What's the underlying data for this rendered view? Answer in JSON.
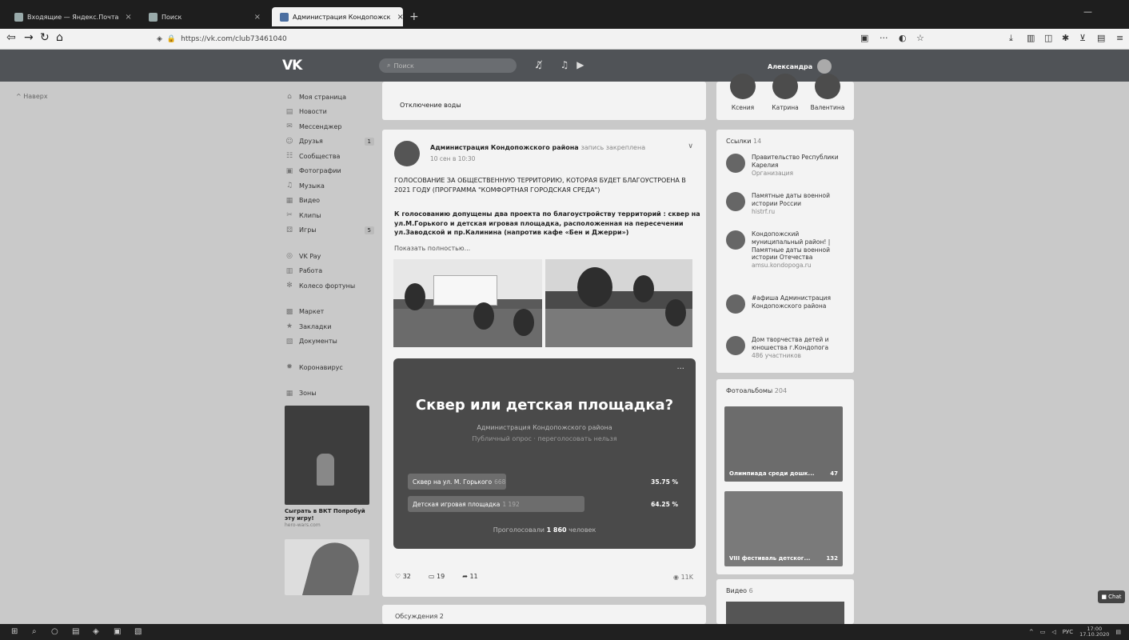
{
  "browser": {
    "tabs": [
      {
        "label": "Входящие — Яндекс.Почта",
        "active": false
      },
      {
        "label": "Поиск",
        "active": false
      },
      {
        "label": "Администрация Кондопожск",
        "active": true
      }
    ],
    "url": "https://vk.com/club73461040",
    "win_min": "—",
    "new_tab": "+"
  },
  "vk": {
    "logo": "VK",
    "search_placeholder": "Поиск",
    "user_name": "Александра"
  },
  "back_link": "Наверх",
  "nav": {
    "items": [
      {
        "label": "Моя страница",
        "icon": "home-icon",
        "glyph": "⌂"
      },
      {
        "label": "Новости",
        "icon": "news-icon",
        "glyph": "▤"
      },
      {
        "label": "Мессенджер",
        "icon": "chat-icon",
        "glyph": "✉"
      },
      {
        "label": "Друзья",
        "icon": "friends-icon",
        "glyph": "☺",
        "count": "1"
      },
      {
        "label": "Сообщества",
        "icon": "groups-icon",
        "glyph": "☷"
      },
      {
        "label": "Фотографии",
        "icon": "photo-icon",
        "glyph": "▣"
      },
      {
        "label": "Музыка",
        "icon": "music-icon",
        "glyph": "♫"
      },
      {
        "label": "Видео",
        "icon": "video-icon",
        "glyph": "▦"
      },
      {
        "label": "Клипы",
        "icon": "clips-icon",
        "glyph": "✂"
      },
      {
        "label": "Игры",
        "icon": "games-icon",
        "glyph": "⚄",
        "count": "5"
      }
    ],
    "items2": [
      {
        "label": "VK Pay",
        "icon": "vkpay-icon",
        "glyph": "◎"
      },
      {
        "label": "Работа",
        "icon": "work-icon",
        "glyph": "▥"
      },
      {
        "label": "Колесо фортуны",
        "icon": "wheel-icon",
        "glyph": "✻"
      }
    ],
    "items3": [
      {
        "label": "Маркет",
        "icon": "market-icon",
        "glyph": "▩"
      },
      {
        "label": "Закладки",
        "icon": "bookmark-icon",
        "glyph": "★"
      },
      {
        "label": "Документы",
        "icon": "docs-icon",
        "glyph": "▧"
      }
    ],
    "items4": [
      {
        "label": "Коронавирус",
        "icon": "virus-icon",
        "glyph": "✹"
      }
    ],
    "items5": [
      {
        "label": "Зоны",
        "icon": "zones-icon",
        "glyph": "▦"
      }
    ],
    "promo_title": "Сыграть в ВКТ Попробуй эту игру!",
    "promo_url": "hero-wars.com"
  },
  "feed": {
    "top_card_title": "Отключение воды",
    "post": {
      "author": "Администрация Кондопожского района",
      "pinned": "запись закреплена",
      "date": "10 сен в 10:30",
      "headline": "ГОЛОСОВАНИЕ ЗА ОБЩЕСТВЕННУЮ ТЕРРИТОРИЮ, КОТОРАЯ БУДЕТ БЛАГОУСТРОЕНА В 2021 ГОДУ (ПРОГРАММА \"КОМФОРТНАЯ ГОРОДСКАЯ СРЕДА\")",
      "body": "К голосованию допущены два проекта по благоустройству территорий : сквер на ул.М.Горького и детская игровая площадка, расположенная на пересечении ул.Заводской и пр.Калинина (напротив кафе «Бен и Джерри»)",
      "show_more": "Показать полностью...",
      "likes": "32",
      "comments": "19",
      "shares": "11",
      "views": "11K"
    },
    "poll": {
      "question": "Сквер или детская площадка?",
      "owner": "Администрация Кондопожского района",
      "kind": "Публичный опрос · переголосовать нельзя",
      "options": [
        {
          "label": "Сквер на ул. М. Горького",
          "count": "668",
          "pct": "35.75 %",
          "fraction": 0.3575
        },
        {
          "label": "Детская игровая площадка",
          "count": "1 192",
          "pct": "64.25 %",
          "fraction": 0.6425
        }
      ],
      "voted_prefix": "Проголосовали",
      "voted_count": "1 860",
      "voted_suffix": "человек"
    },
    "discussions": "Обсуждения 2"
  },
  "right": {
    "friends": [
      "Ксения",
      "Катрина",
      "Валентина"
    ],
    "links_label": "Ссылки",
    "links_count": "14",
    "links": [
      {
        "title": "Правительство Республики Карелия",
        "sub": "Организация"
      },
      {
        "title": "Памятные даты военной истории России",
        "sub": "histrf.ru"
      },
      {
        "title": "Кондопожский муниципальный район! | Памятные даты военной истории Отечества",
        "sub": "amsu.kondopoga.ru"
      },
      {
        "title": "#афиша Администрация Кондопожского района",
        "sub": ""
      },
      {
        "title": "Дом творчества детей и юношества г.Кондопога",
        "sub": "486 участников"
      }
    ],
    "albums_label": "Фотоальбомы",
    "albums_count": "204",
    "albums": [
      {
        "title": "Олимпиада среди дошк...",
        "count": "47"
      },
      {
        "title": "VIII фестиваль детског...",
        "count": "132"
      }
    ],
    "video_label": "Видео",
    "video_count": "6"
  },
  "chat_button": "Chat",
  "taskbar": {
    "lang": "РУС",
    "time": "17:00",
    "date": "17.10.2020"
  }
}
